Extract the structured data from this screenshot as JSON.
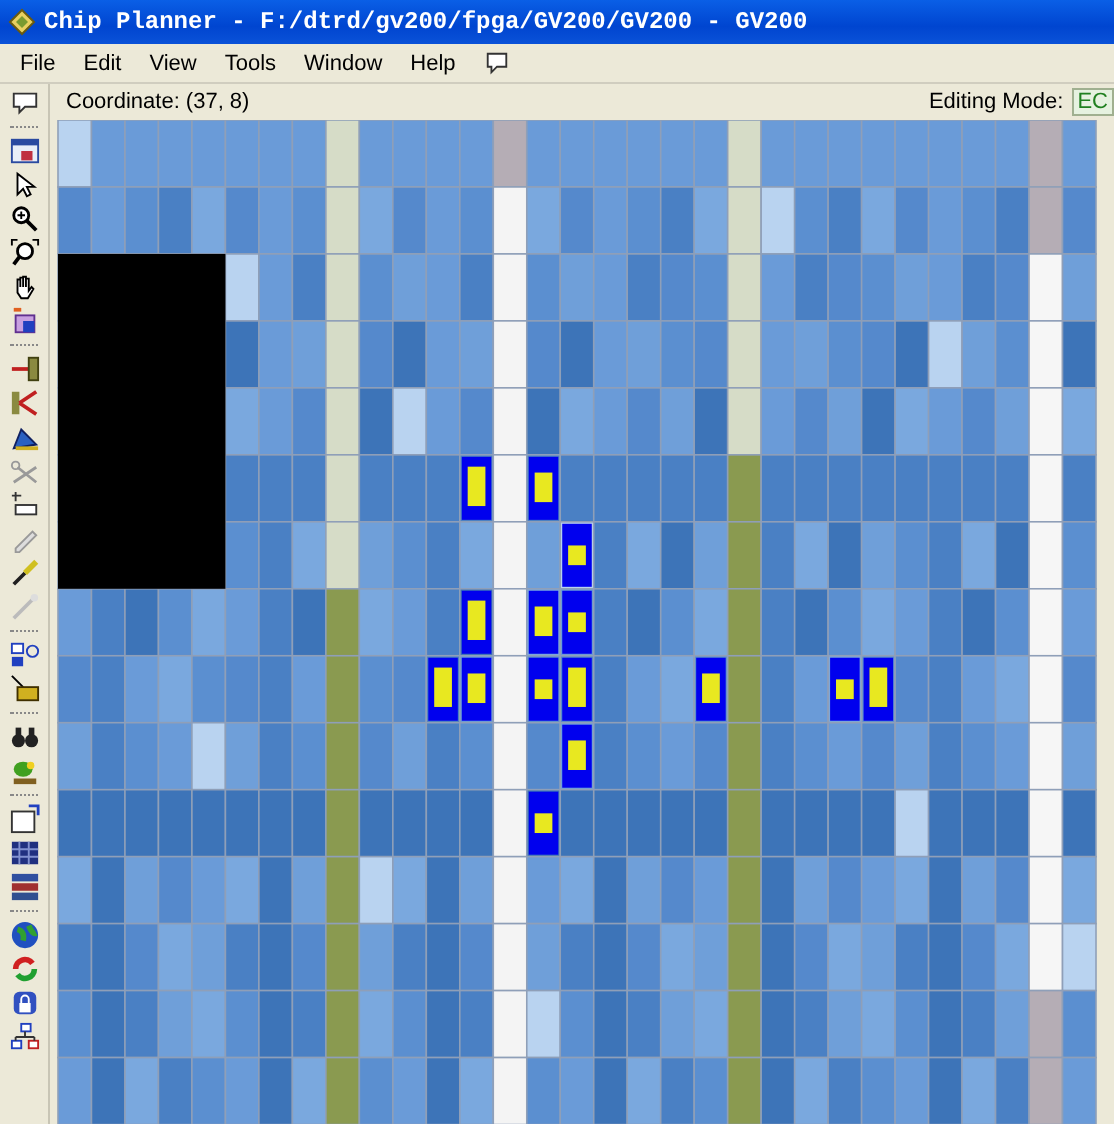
{
  "window": {
    "title": "Chip Planner - F:/dtrd/gv200/fpga/GV200/GV200 - GV200"
  },
  "menu": [
    "File",
    "Edit",
    "View",
    "Tools",
    "Window",
    "Help"
  ],
  "status": {
    "coordinate": "Coordinate: (37, 8)",
    "editing_mode_label": "Editing Mode:",
    "editing_mode_value": "EC"
  }
}
